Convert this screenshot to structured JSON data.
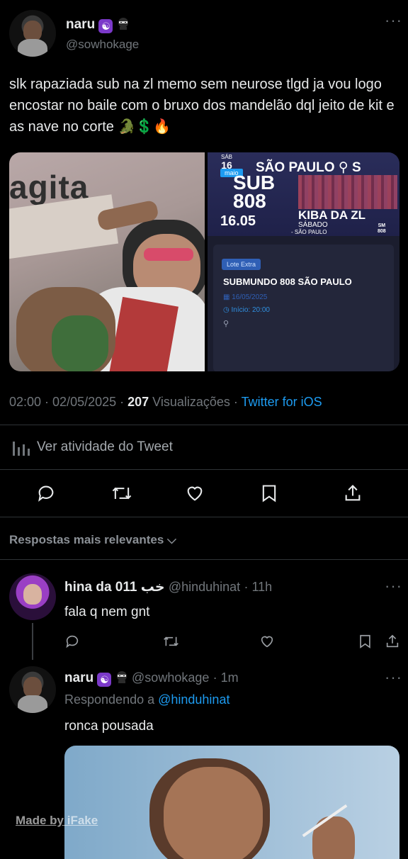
{
  "tweet": {
    "display_name": "naru",
    "handle": "@sowhokage",
    "badge_glyph": "☯",
    "text": "slk rapaziada sub na zl memo sem neurose tlgd ja vou logo encostar no baile com o bruxo dos mandelão dql jeito de kit e as nave no corte",
    "emoji_tail": "🐊💲🔥",
    "time": "02:00 · 02/05/2025 · ",
    "views_count": "207",
    "views_label": " Visualizações · ",
    "source": "Twitter for iOS",
    "activity_label": "Ver atividade do Tweet"
  },
  "media": {
    "left_sign_text": "agita",
    "ticket": {
      "day_label": "SÁB",
      "day_number": "16",
      "month": "maio",
      "city": "SÃO PAULO",
      "city_suffix": "S",
      "event_line1": "SUB",
      "event_line2": "808",
      "date": "16.05",
      "artist": "KIBA DA ZL",
      "weekday": "SÁBADO",
      "place": "- SÃO PAULO",
      "brand_line1": "SM",
      "brand_line2": "808",
      "lot_badge": "Lote Extra",
      "event_title": "SUBMUNDO 808 SÃO PAULO",
      "event_date": "16/05/2025",
      "event_start": "Início: 20:00"
    }
  },
  "replies_header": "Respostas mais relevantes",
  "reply1": {
    "display_name": "hina da 011",
    "name_suffix": "خب",
    "handle": "@hinduhinat",
    "time": "· 11h",
    "text": "fala q nem gnt"
  },
  "reply2": {
    "display_name": "naru",
    "handle": "@sowhokage",
    "time": "· 1m",
    "replying_label": "Respondendo a ",
    "replying_to": "@hinduhinat",
    "text": "ronca pousada"
  },
  "watermark": "Made by iFake",
  "colors": {
    "background": "#000000",
    "text": "#e7e9ea",
    "muted": "#71767b",
    "accent": "#1d9bf0",
    "divider": "#2f3336",
    "badge": "#7b39c9"
  },
  "icons": [
    "more-icon",
    "reply-icon",
    "retweet-icon",
    "like-icon",
    "bookmark-icon",
    "share-icon",
    "analytics-icon",
    "chevron-down-icon",
    "ninja-icon",
    "yin-yang-icon"
  ]
}
